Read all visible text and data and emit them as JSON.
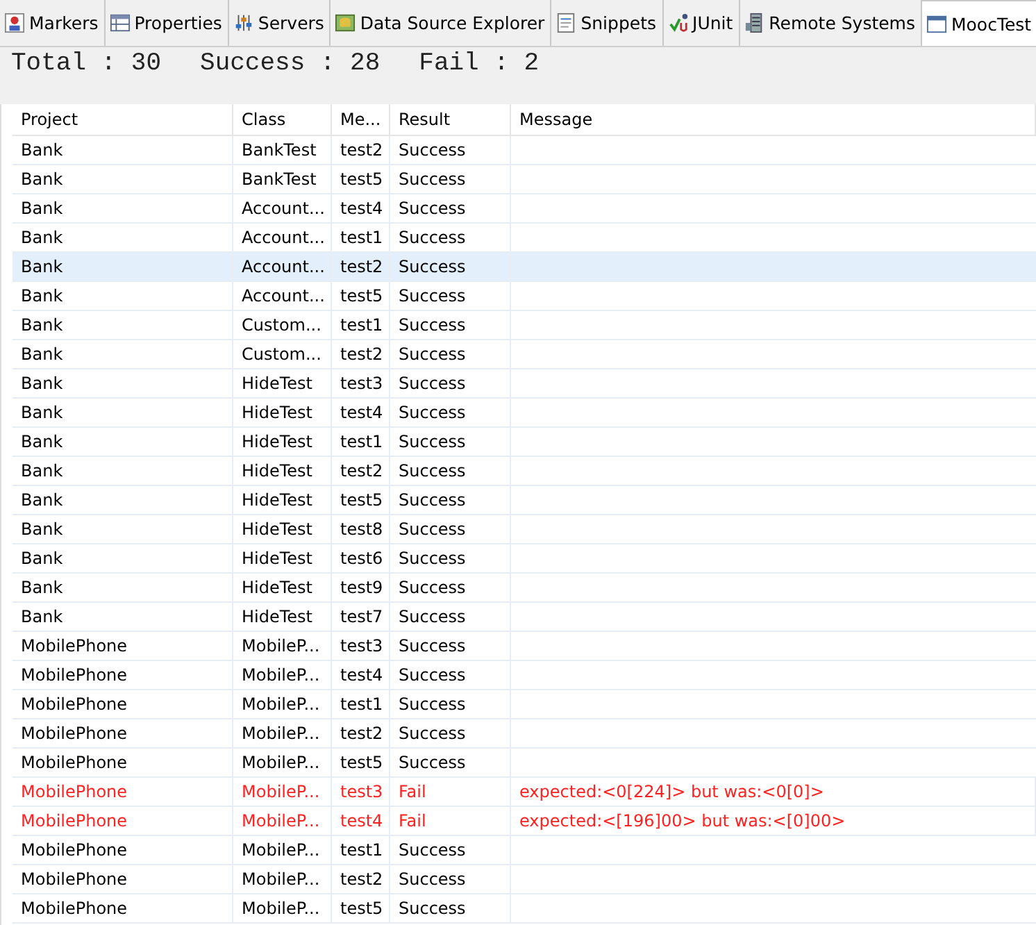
{
  "tabs": [
    {
      "label": "Markers",
      "kind": "markers",
      "selected": false
    },
    {
      "label": "Properties",
      "kind": "properties",
      "selected": false
    },
    {
      "label": "Servers",
      "kind": "servers",
      "selected": false
    },
    {
      "label": "Data Source Explorer",
      "kind": "datasource",
      "selected": false
    },
    {
      "label": "Snippets",
      "kind": "snippets",
      "selected": false
    },
    {
      "label": "JUnit",
      "kind": "junit",
      "selected": false
    },
    {
      "label": "Remote Systems",
      "kind": "remote",
      "selected": false
    },
    {
      "label": "MoocTest",
      "kind": "window",
      "selected": true
    }
  ],
  "summary": [
    "Total : 30",
    "Success : 28",
    "Fail : 2"
  ],
  "table": {
    "columns": [
      "Project",
      "Class",
      "Me...",
      "Result",
      "Message"
    ],
    "rows": [
      {
        "cells": [
          "Bank",
          "BankTest",
          "test2",
          "Success",
          ""
        ],
        "failed": false,
        "selected": false
      },
      {
        "cells": [
          "Bank",
          "BankTest",
          "test5",
          "Success",
          ""
        ],
        "failed": false,
        "selected": false
      },
      {
        "cells": [
          "Bank",
          "Account...",
          "test4",
          "Success",
          ""
        ],
        "failed": false,
        "selected": false
      },
      {
        "cells": [
          "Bank",
          "Account...",
          "test1",
          "Success",
          ""
        ],
        "failed": false,
        "selected": false
      },
      {
        "cells": [
          "Bank",
          "Account...",
          "test2",
          "Success",
          ""
        ],
        "failed": false,
        "selected": true
      },
      {
        "cells": [
          "Bank",
          "Account...",
          "test5",
          "Success",
          ""
        ],
        "failed": false,
        "selected": false
      },
      {
        "cells": [
          "Bank",
          "Custom...",
          "test1",
          "Success",
          ""
        ],
        "failed": false,
        "selected": false
      },
      {
        "cells": [
          "Bank",
          "Custom...",
          "test2",
          "Success",
          ""
        ],
        "failed": false,
        "selected": false
      },
      {
        "cells": [
          "Bank",
          "HideTest",
          "test3",
          "Success",
          ""
        ],
        "failed": false,
        "selected": false
      },
      {
        "cells": [
          "Bank",
          "HideTest",
          "test4",
          "Success",
          ""
        ],
        "failed": false,
        "selected": false
      },
      {
        "cells": [
          "Bank",
          "HideTest",
          "test1",
          "Success",
          ""
        ],
        "failed": false,
        "selected": false
      },
      {
        "cells": [
          "Bank",
          "HideTest",
          "test2",
          "Success",
          ""
        ],
        "failed": false,
        "selected": false
      },
      {
        "cells": [
          "Bank",
          "HideTest",
          "test5",
          "Success",
          ""
        ],
        "failed": false,
        "selected": false
      },
      {
        "cells": [
          "Bank",
          "HideTest",
          "test8",
          "Success",
          ""
        ],
        "failed": false,
        "selected": false
      },
      {
        "cells": [
          "Bank",
          "HideTest",
          "test6",
          "Success",
          ""
        ],
        "failed": false,
        "selected": false
      },
      {
        "cells": [
          "Bank",
          "HideTest",
          "test9",
          "Success",
          ""
        ],
        "failed": false,
        "selected": false
      },
      {
        "cells": [
          "Bank",
          "HideTest",
          "test7",
          "Success",
          ""
        ],
        "failed": false,
        "selected": false
      },
      {
        "cells": [
          "MobilePhone",
          "MobileP...",
          "test3",
          "Success",
          ""
        ],
        "failed": false,
        "selected": false
      },
      {
        "cells": [
          "MobilePhone",
          "MobileP...",
          "test4",
          "Success",
          ""
        ],
        "failed": false,
        "selected": false
      },
      {
        "cells": [
          "MobilePhone",
          "MobileP...",
          "test1",
          "Success",
          ""
        ],
        "failed": false,
        "selected": false
      },
      {
        "cells": [
          "MobilePhone",
          "MobileP...",
          "test2",
          "Success",
          ""
        ],
        "failed": false,
        "selected": false
      },
      {
        "cells": [
          "MobilePhone",
          "MobileP...",
          "test5",
          "Success",
          ""
        ],
        "failed": false,
        "selected": false
      },
      {
        "cells": [
          "MobilePhone",
          "MobileP...",
          "test3",
          "Fail",
          "expected:<0[224]> but was:<0[0]>"
        ],
        "failed": true,
        "selected": false
      },
      {
        "cells": [
          "MobilePhone",
          "MobileP...",
          "test4",
          "Fail",
          "expected:<[196]00> but was:<[0]00>"
        ],
        "failed": true,
        "selected": false
      },
      {
        "cells": [
          "MobilePhone",
          "MobileP...",
          "test1",
          "Success",
          ""
        ],
        "failed": false,
        "selected": false
      },
      {
        "cells": [
          "MobilePhone",
          "MobileP...",
          "test2",
          "Success",
          ""
        ],
        "failed": false,
        "selected": false
      },
      {
        "cells": [
          "MobilePhone",
          "MobileP...",
          "test5",
          "Success",
          ""
        ],
        "failed": false,
        "selected": false
      }
    ]
  }
}
